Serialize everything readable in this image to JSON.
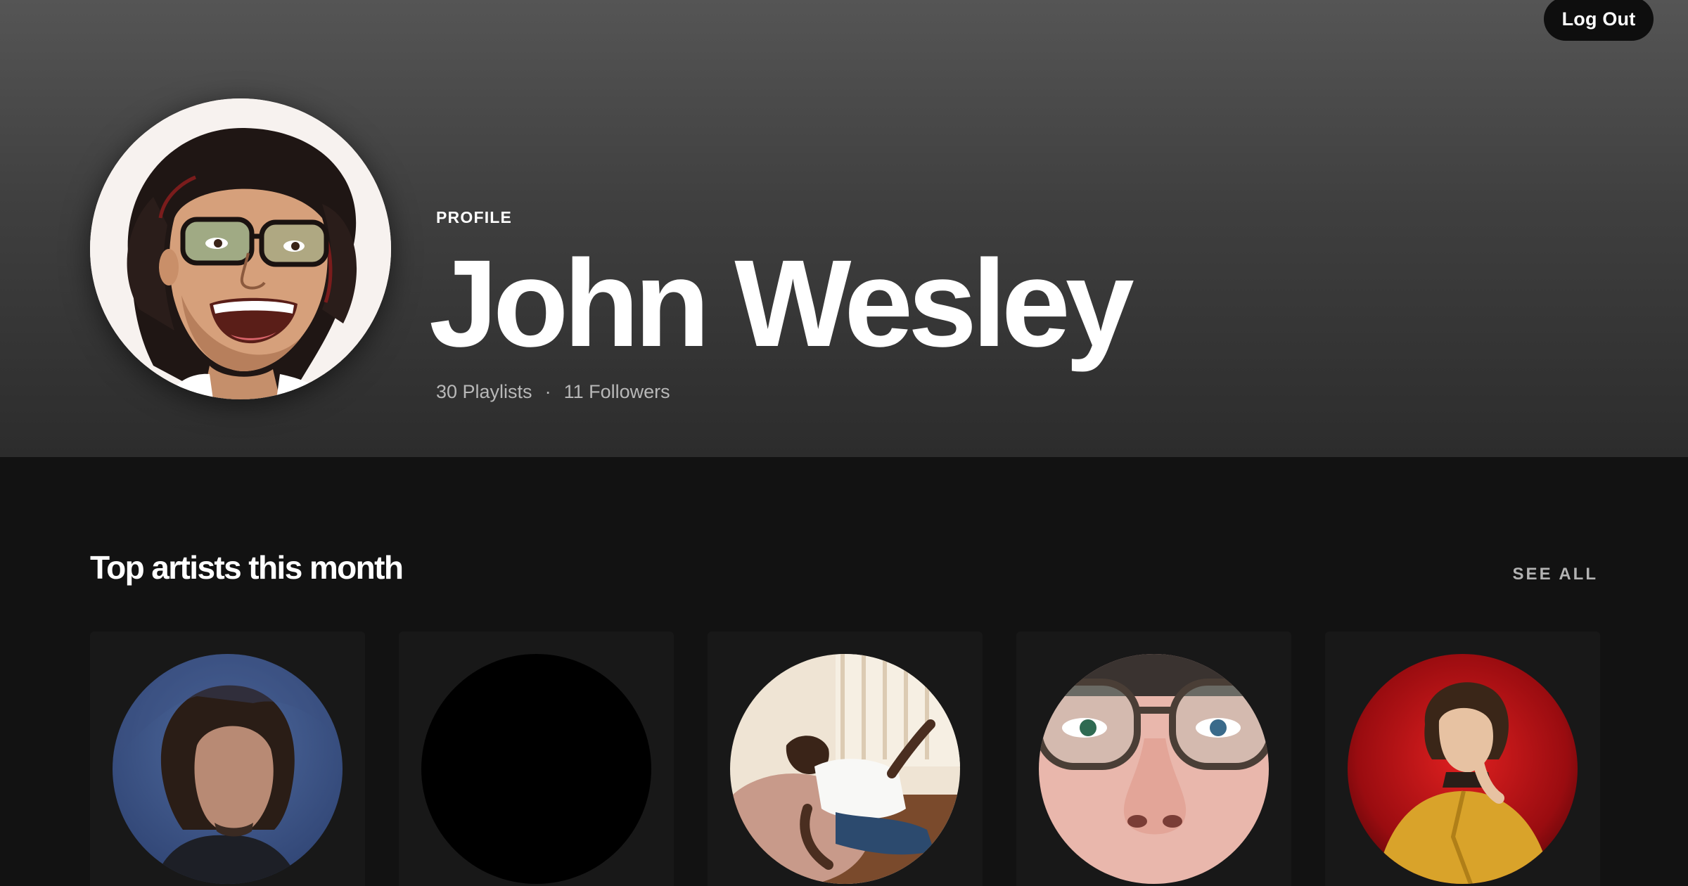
{
  "header": {
    "logout_label": "Log Out",
    "profile_label": "PROFILE",
    "name": "John Wesley",
    "playlists": "30 Playlists",
    "separator": "·",
    "followers": "11 Followers"
  },
  "top_artists": {
    "title": "Top artists this month",
    "see_all_label": "SEE ALL",
    "artists": [
      {
        "image": "artist-photo-long-hair-blue-background"
      },
      {
        "image": "artist-photo-black"
      },
      {
        "image": "artist-photo-reclining-on-beanbag"
      },
      {
        "image": "artist-photo-closeup-glasses"
      },
      {
        "image": "artist-photo-red-background-yellow-shirt"
      }
    ]
  },
  "colors": {
    "header_top": "#555555",
    "header_bottom": "#2c2c2c",
    "background": "#121212",
    "card": "#181818",
    "button": "#0e0e0e",
    "muted_text": "#b3b3b3"
  }
}
